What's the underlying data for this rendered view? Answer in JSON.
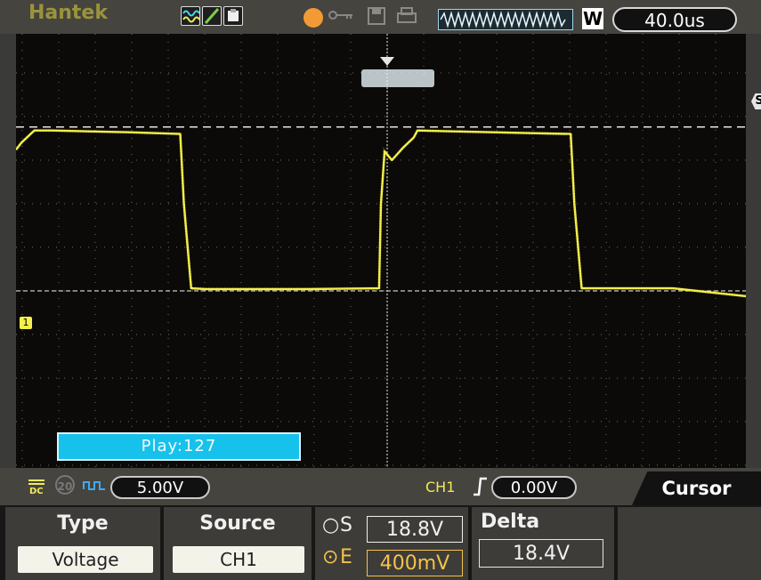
{
  "topbar": {
    "brand": "Hantek",
    "timebase": "40.0us",
    "window_badge": "W",
    "trigger_state_color": "#f39a34",
    "icons": [
      "waveform-icon",
      "cursor-line-icon",
      "print-icon",
      "key-icon",
      "save-icon",
      "printer-icon"
    ]
  },
  "screen": {
    "trace_color": "#f5ef4a",
    "grid_color": "#9a9a8a",
    "ch1_marker": "1",
    "cursor_s_marker": "S",
    "play_label": "Play:127"
  },
  "chart_data": {
    "type": "line",
    "title": "",
    "xlabel": "",
    "ylabel": "",
    "x_unit": "us",
    "y_unit": "V",
    "xlim": [
      -200,
      200
    ],
    "ylim": [
      -25,
      25
    ],
    "x_per_div": 40,
    "y_per_div": 5,
    "series": [
      {
        "x": [
          -200,
          -197,
          -190,
          -180,
          -160,
          -140,
          -110,
          -108,
          -104,
          -96,
          -80,
          -40,
          -1,
          0,
          2,
          6,
          12,
          18,
          20,
          40,
          80,
          104,
          106,
          110,
          118,
          160,
          200
        ],
        "y": [
          16.2,
          17.0,
          18.4,
          18.4,
          18.3,
          18.2,
          18.0,
          10.0,
          0.3,
          0.2,
          0.2,
          0.2,
          0.3,
          10.0,
          16.0,
          15.0,
          16.4,
          17.6,
          18.4,
          18.3,
          18.1,
          18.0,
          10.0,
          0.3,
          0.3,
          0.3,
          -0.6
        ]
      }
    ],
    "cursor_lines": {
      "S": 18.8,
      "E": 0.4
    },
    "grid": true
  },
  "status": {
    "coupling_icon": "dc-coupling-icon",
    "bw_limit": "20",
    "volts_div": "5.00V",
    "trigger_source": "CH1",
    "trigger_level": "0.00V",
    "menu_title": "Cursor"
  },
  "menu": {
    "type_title": "Type",
    "type_value": "Voltage",
    "source_title": "Source",
    "source_value": "CH1",
    "s_label": "S",
    "s_value": "18.8V",
    "e_label": "E",
    "e_value": "400mV",
    "delta_title": "Delta",
    "delta_value": "18.4V"
  }
}
